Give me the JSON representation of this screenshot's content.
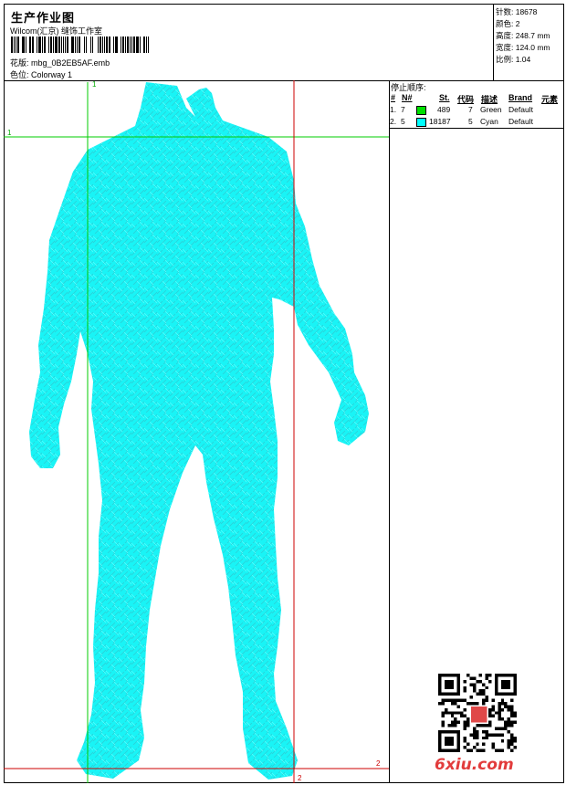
{
  "header": {
    "title": "生产作业图",
    "studio": "Wilcom(汇京) 缝饰工作室",
    "design_label": "花版:",
    "design_file": "mbg_0B2EB5AF.emb",
    "colorway_label": "色位:",
    "colorway": "Colorway 1"
  },
  "stats": {
    "stitches": "针数: 18678",
    "colors": "颜色: 2",
    "height": "高度: 248.7 mm",
    "width": "宽度: 124.0 mm",
    "scale": "比例: 1.04"
  },
  "stop_sequence": {
    "title": "停止顺序:",
    "columns": [
      "#",
      "N#",
      "St.",
      "代码",
      "描述",
      "Brand",
      "元素"
    ],
    "rows": [
      {
        "index": "1.",
        "needle": "7",
        "color": "#00e000",
        "stitches": "489",
        "code": "7",
        "description": "Green",
        "brand": "Default"
      },
      {
        "index": "2.",
        "needle": "5",
        "color": "#00ffff",
        "stitches": "18187",
        "code": "5",
        "description": "Cyan",
        "brand": "Default"
      }
    ]
  },
  "guides": {
    "label_1_top": "1",
    "label_1_left": "1",
    "label_2_right": "2",
    "label_2_bottom": "2"
  },
  "embroidery": {
    "fill_color": "#00ffff",
    "stitch_color": "#22d8dc"
  },
  "watermark": "6xiu.com",
  "colors": {
    "green_guide": "#00cc00",
    "red_guide": "#cc0000"
  }
}
